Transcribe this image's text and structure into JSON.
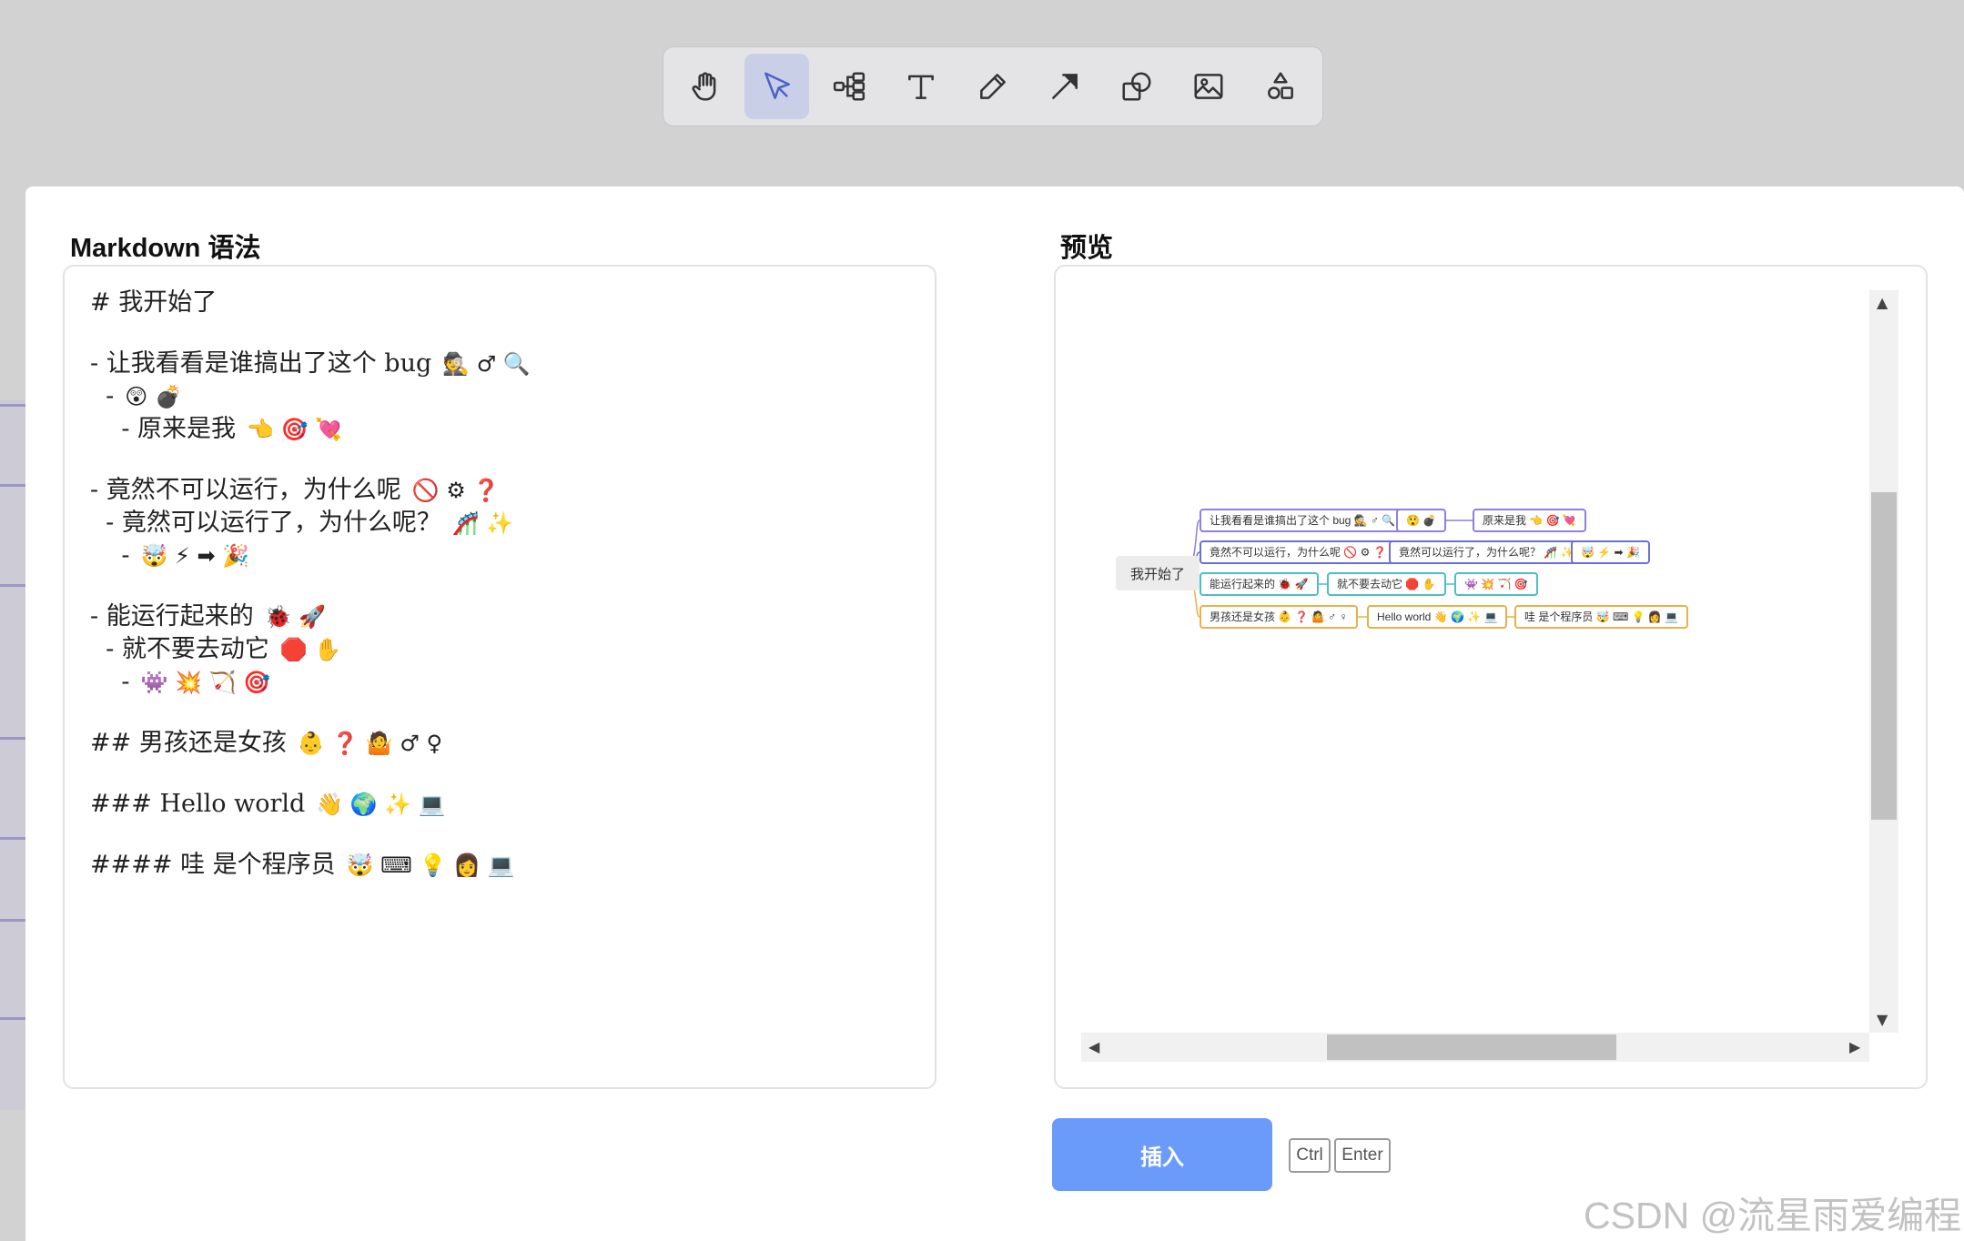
{
  "toolbar": {
    "tools": [
      {
        "name": "hand",
        "active": false
      },
      {
        "name": "select",
        "active": true
      },
      {
        "name": "mindmap",
        "active": false
      },
      {
        "name": "text",
        "active": false
      },
      {
        "name": "pen",
        "active": false
      },
      {
        "name": "arrow",
        "active": false
      },
      {
        "name": "shape",
        "active": false
      },
      {
        "name": "image",
        "active": false
      },
      {
        "name": "more-shapes",
        "active": false
      }
    ]
  },
  "editor": {
    "title": "Markdown 语法",
    "lines": [
      {
        "text": "# 我开始了",
        "emoji": ""
      },
      {
        "text": "",
        "emoji": ""
      },
      {
        "text": "- 让我看看是谁搞出了这个 bug",
        "emoji": "🕵 ♂ 🔍"
      },
      {
        "text": "  -",
        "emoji": "😲 💣"
      },
      {
        "text": "    - 原来是我",
        "emoji": "👈 🎯 💘"
      },
      {
        "text": "",
        "emoji": ""
      },
      {
        "text": "- 竟然不可以运行，为什么呢",
        "emoji": "🚫 ⚙ ❓"
      },
      {
        "text": "  - 竟然可以运行了，为什么呢？",
        "emoji": "🎢 ✨"
      },
      {
        "text": "    -",
        "emoji": "🤯 ⚡ ➡ 🎉"
      },
      {
        "text": "",
        "emoji": ""
      },
      {
        "text": "- 能运行起来的",
        "emoji": "🐞 🚀"
      },
      {
        "text": "  - 就不要去动它",
        "emoji": "🛑 ✋"
      },
      {
        "text": "    -",
        "emoji": "👾 💥 🏹 🎯"
      },
      {
        "text": "",
        "emoji": ""
      },
      {
        "text": "## 男孩还是女孩",
        "emoji": "👶 ❓ 🤷 ♂ ♀"
      },
      {
        "text": "",
        "emoji": ""
      },
      {
        "text": "### Hello world",
        "emoji": "👋 🌍 ✨ 💻"
      },
      {
        "text": "",
        "emoji": ""
      },
      {
        "text": "#### 哇 是个程序员",
        "emoji": "🤯 ⌨ 💡 👩 💻"
      }
    ]
  },
  "preview": {
    "title": "预览",
    "root": "我开始了",
    "branches": [
      {
        "color": "#8e7fe0",
        "nodes": [
          "让我看看是谁搞出了这个 bug 🕵 ♂ 🔍",
          "😲 💣",
          "原来是我 👈 🎯 💘"
        ]
      },
      {
        "color": "#6a6fd6",
        "nodes": [
          "竟然不可以运行，为什么呢 🚫 ⚙ ❓",
          "竟然可以运行了，为什么呢？ 🎢 ✨",
          "🤯 ⚡ ➡ 🎉"
        ]
      },
      {
        "color": "#4dbfbf",
        "nodes": [
          "能运行起来的 🐞 🚀",
          "就不要去动它 🛑 ✋",
          "👾 💥 🏹 🎯"
        ]
      },
      {
        "color": "#e8b24a",
        "nodes": [
          "男孩还是女孩 👶 ❓ 🤷 ♂ ♀",
          "Hello world 👋 🌍 ✨ 💻",
          "哇 是个程序员 🤯 ⌨ 💡 👩 💻"
        ]
      }
    ]
  },
  "actions": {
    "insert_label": "插入",
    "shortcut_ctrl": "Ctrl",
    "shortcut_enter": "Enter"
  },
  "watermark": "CSDN @流星雨爱编程"
}
